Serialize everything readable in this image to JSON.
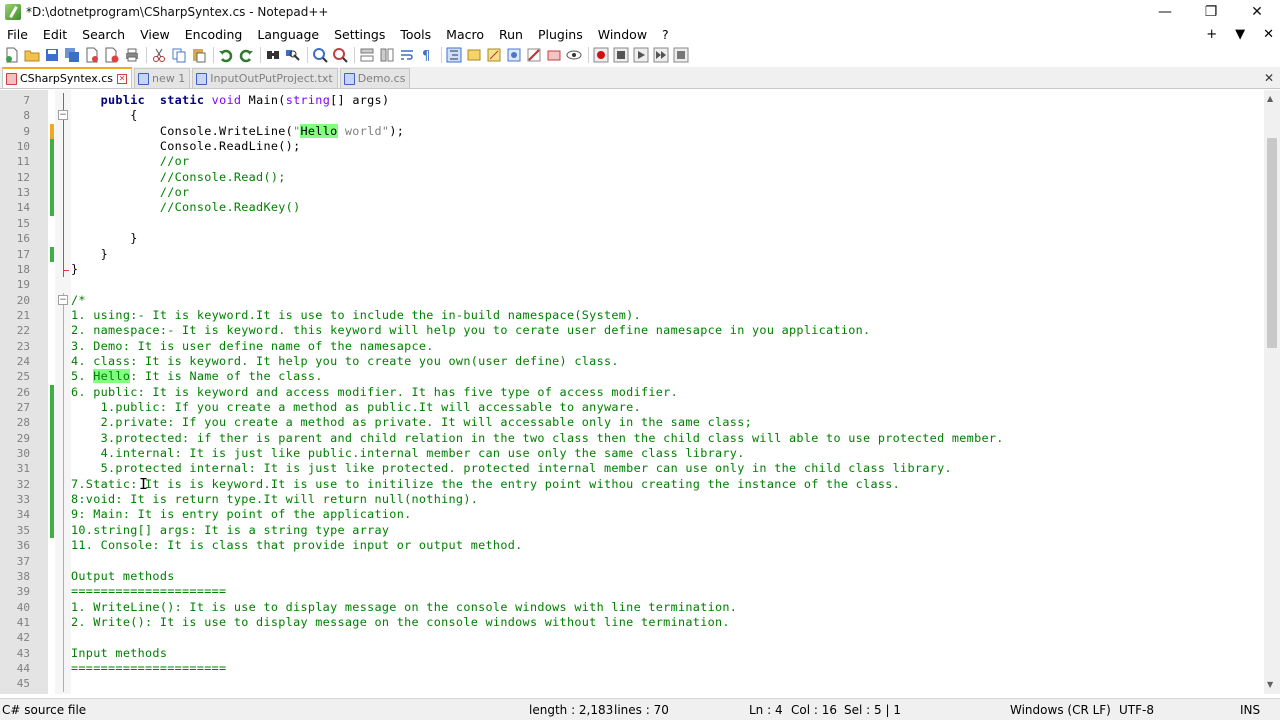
{
  "window": {
    "title": "*D:\\dotnetprogram\\CSharpSyntex.cs - Notepad++",
    "controls": {
      "minimize": "—",
      "maximize": "❐",
      "close": "✕"
    }
  },
  "menu": {
    "items": [
      "File",
      "Edit",
      "Search",
      "View",
      "Encoding",
      "Language",
      "Settings",
      "Tools",
      "Macro",
      "Run",
      "Plugins",
      "Window",
      "?"
    ],
    "right": {
      "plus": "+",
      "dropdown": "▼",
      "close": "✕"
    }
  },
  "toolbar": {
    "icons": [
      "new-file-icon",
      "open-file-icon",
      "save-icon",
      "save-all-icon",
      "close-icon",
      "close-all-icon",
      "print-icon",
      "cut-icon",
      "copy-icon",
      "paste-icon",
      "undo-icon",
      "redo-icon",
      "find-icon",
      "replace-icon",
      "zoom-in-icon",
      "zoom-out-icon",
      "sync-vertical-icon",
      "sync-horizontal-icon",
      "word-wrap-icon",
      "show-all-chars-icon",
      "indent-guide-icon",
      "doc-map-icon",
      "function-list-icon",
      "folder-as-workspace-icon",
      "monitoring-icon",
      "record-macro-icon",
      "stop-macro-icon",
      "play-macro-icon",
      "run-macro-multiple-icon",
      "save-macro-icon"
    ]
  },
  "tabs": [
    {
      "label": "CSharpSyntex.cs",
      "active": true,
      "icon_color": "#d04040"
    },
    {
      "label": "new 1",
      "active": false,
      "icon_color": "#4060c0"
    },
    {
      "label": "InputOutPutProject.txt",
      "active": false,
      "icon_color": "#4060c0"
    },
    {
      "label": "Demo.cs",
      "active": false,
      "icon_color": "#4060c0"
    }
  ],
  "tab_close_all": "✕",
  "editor": {
    "lines": [
      {
        "n": "7",
        "segs": [
          [
            "",
            "    "
          ],
          [
            "kw",
            "public"
          ],
          [
            "",
            "  "
          ],
          [
            "kw",
            "static"
          ],
          [
            "",
            " "
          ],
          [
            "kt",
            "void"
          ],
          [
            "",
            " Main("
          ],
          [
            "kt",
            "string"
          ],
          [
            "",
            "[] args)"
          ]
        ]
      },
      {
        "n": "8",
        "segs": [
          [
            "",
            "        {"
          ]
        ]
      },
      {
        "n": "9",
        "segs": [
          [
            "",
            "            Console.WriteLine("
          ],
          [
            "str",
            "\""
          ],
          [
            "hl",
            "Hello"
          ],
          [
            "str",
            " world\""
          ],
          [
            "",
            ");"
          ]
        ]
      },
      {
        "n": "10",
        "segs": [
          [
            "",
            "            Console.ReadLine();"
          ]
        ]
      },
      {
        "n": "11",
        "segs": [
          [
            "",
            "            "
          ],
          [
            "cm",
            "//or"
          ]
        ]
      },
      {
        "n": "12",
        "segs": [
          [
            "",
            "            "
          ],
          [
            "cm",
            "//Console.Read();"
          ]
        ]
      },
      {
        "n": "13",
        "segs": [
          [
            "",
            "            "
          ],
          [
            "cm",
            "//or"
          ]
        ]
      },
      {
        "n": "14",
        "segs": [
          [
            "",
            "            "
          ],
          [
            "cm",
            "//Console.ReadKey()"
          ]
        ]
      },
      {
        "n": "15",
        "segs": [
          [
            "",
            ""
          ]
        ]
      },
      {
        "n": "16",
        "segs": [
          [
            "",
            "        }"
          ]
        ]
      },
      {
        "n": "17",
        "segs": [
          [
            "",
            "    }"
          ]
        ]
      },
      {
        "n": "18",
        "segs": [
          [
            "",
            "}"
          ]
        ]
      },
      {
        "n": "19",
        "segs": [
          [
            "",
            ""
          ]
        ]
      },
      {
        "n": "20",
        "segs": [
          [
            "cm",
            "/*"
          ]
        ]
      },
      {
        "n": "21",
        "segs": [
          [
            "cm",
            "1. using:- It is keyword.It is use to include the in-build namespace(System)."
          ]
        ]
      },
      {
        "n": "22",
        "segs": [
          [
            "cm",
            "2. namespace:- It is keyword. this keyword will help you to cerate user define namesapce in you application."
          ]
        ]
      },
      {
        "n": "23",
        "segs": [
          [
            "cm",
            "3. Demo: It is user define name of the namesapce."
          ]
        ]
      },
      {
        "n": "24",
        "segs": [
          [
            "cm",
            "4. class: It is keyword. It help you to create you own(user define) class."
          ]
        ]
      },
      {
        "n": "25",
        "segs": [
          [
            "cm",
            "5. "
          ],
          [
            "hl cm",
            "Hello"
          ],
          [
            "cm",
            ": It is Name of the class."
          ]
        ]
      },
      {
        "n": "26",
        "segs": [
          [
            "cm",
            "6. public: It is keyword and access modifier. It has five type of access modifier."
          ]
        ]
      },
      {
        "n": "27",
        "segs": [
          [
            "cm",
            "    1.public: If you create a method as public.It will accessable to anyware."
          ]
        ]
      },
      {
        "n": "28",
        "segs": [
          [
            "cm",
            "    2.private: If you create a method as private. It will accessable only in the same class;"
          ]
        ]
      },
      {
        "n": "29",
        "segs": [
          [
            "cm",
            "    3.protected: if ther is parent and child relation in the two class then the child class will able to use protected member."
          ]
        ]
      },
      {
        "n": "30",
        "segs": [
          [
            "cm",
            "    4.internal: It is just like public.internal member can use only the same class library."
          ]
        ]
      },
      {
        "n": "31",
        "segs": [
          [
            "cm",
            "    5.protected internal: It is just like protected. protected internal member can use only in the child class library."
          ]
        ]
      },
      {
        "n": "32",
        "segs": [
          [
            "cm",
            "7.Static: It is is keyword.It is use to initilize the the entry point withou creating the instance of the class."
          ]
        ]
      },
      {
        "n": "33",
        "segs": [
          [
            "cm",
            "8:void: It is return type.It will return null(nothing)."
          ]
        ]
      },
      {
        "n": "34",
        "segs": [
          [
            "cm",
            "9: Main: It is entry point of the application."
          ]
        ]
      },
      {
        "n": "35",
        "segs": [
          [
            "cm",
            "10.string[] args: It is a string type array"
          ]
        ]
      },
      {
        "n": "36",
        "segs": [
          [
            "cm",
            "11. Console: It is class that provide input or output method."
          ]
        ]
      },
      {
        "n": "37",
        "segs": [
          [
            "cm",
            ""
          ]
        ]
      },
      {
        "n": "38",
        "segs": [
          [
            "cm",
            "Output methods"
          ]
        ]
      },
      {
        "n": "39",
        "segs": [
          [
            "cm",
            "====================="
          ]
        ]
      },
      {
        "n": "40",
        "segs": [
          [
            "cm",
            "1. WriteLine(): It is use to display message on the console windows with line termination."
          ]
        ]
      },
      {
        "n": "41",
        "segs": [
          [
            "cm",
            "2. Write(): It is use to display message on the console windows without line termination."
          ]
        ]
      },
      {
        "n": "42",
        "segs": [
          [
            "cm",
            ""
          ]
        ]
      },
      {
        "n": "43",
        "segs": [
          [
            "cm",
            "Input methods"
          ]
        ]
      },
      {
        "n": "44",
        "segs": [
          [
            "cm",
            "====================="
          ]
        ]
      },
      {
        "n": "45",
        "segs": [
          [
            "cm",
            ""
          ]
        ]
      }
    ]
  },
  "status": {
    "file_type": "C# source file",
    "length": "length : 2,183",
    "lines": "lines : 70",
    "ln": "Ln : 4",
    "col": "Col : 16",
    "sel": "Sel : 5 | 1",
    "eol": "Windows (CR LF)",
    "encoding": "UTF-8",
    "mode": "INS"
  }
}
